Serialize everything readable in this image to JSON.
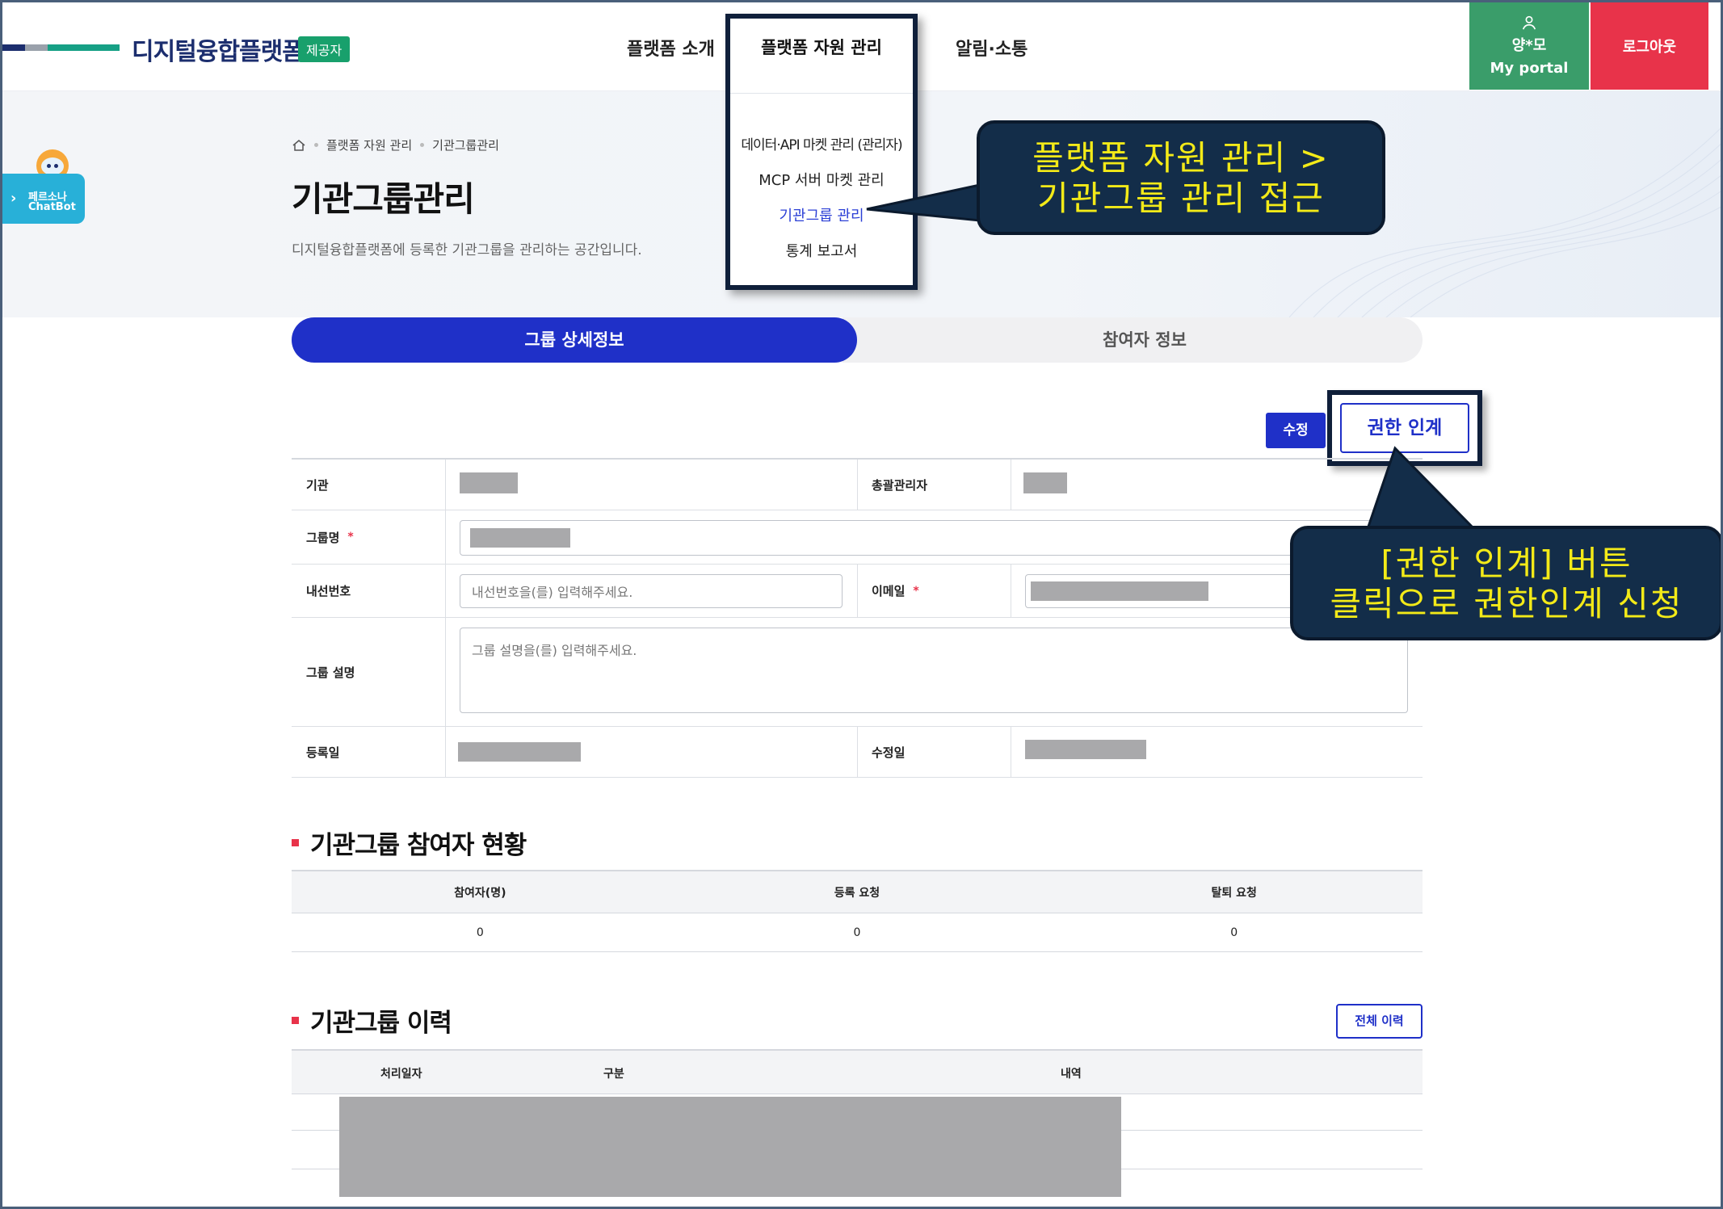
{
  "header": {
    "logo_text": "디지털융합플랫폼",
    "logo_badge": "제공자",
    "nav": [
      "플랫폼 소개",
      "플랫폼 자원 관리",
      "알림·소통"
    ],
    "user_name": "양*모",
    "portal_label": "My portal",
    "logout_label": "로그아웃"
  },
  "dropdown": {
    "title": "플랫폼 자원 관리",
    "items": [
      "데이터·API 마켓 관리 (관리자)",
      "MCP 서버 마켓 관리",
      "기관그룹 관리",
      "통계 보고서"
    ],
    "active_index": 2
  },
  "chatbot": {
    "line1": "페르소나",
    "line2": "ChatBot"
  },
  "breadcrumb": [
    "플랫폼 자원 관리",
    "기관그룹관리"
  ],
  "page": {
    "title": "기관그룹관리",
    "description": "디지털융합플랫폼에 등록한 기관그룹을 관리하는 공간입니다."
  },
  "tabs": [
    {
      "label": "그룹 상세정보",
      "active": true
    },
    {
      "label": "참여자 정보",
      "active": false
    }
  ],
  "actions": {
    "edit": "수정",
    "transfer": "권한 인계"
  },
  "form": {
    "org_label": "기관",
    "admin_label": "총괄관리자",
    "group_name_label": "그룹명",
    "ext_label": "내선번호",
    "ext_placeholder": "내선번호을(를) 입력해주세요.",
    "email_label": "이메일",
    "desc_label": "그룹 설명",
    "desc_placeholder": "그룹 설명을(를) 입력해주세요.",
    "reg_label": "등록일",
    "mod_label": "수정일",
    "required_mark": "*"
  },
  "participants": {
    "title": "기관그룹 참여자 현황",
    "headers": [
      "참여자(명)",
      "등록 요청",
      "탈퇴 요청"
    ],
    "values": [
      "0",
      "0",
      "0"
    ]
  },
  "history": {
    "title": "기관그룹 이력",
    "all_button": "전체 이력",
    "headers": [
      "처리일자",
      "구분",
      "내역"
    ]
  },
  "callouts": {
    "c1_line1": "플랫폼 자원 관리 >",
    "c1_line2": "기관그룹 관리 접근",
    "c2_line1": "[권한 인계] 버튼",
    "c2_line2": "클릭으로 권한인계 신청"
  },
  "colors": {
    "primary": "#1f30c8",
    "brand_navy": "#1c2e6e",
    "portal_green": "#3a9d6a",
    "logout_red": "#e8334a",
    "callout_bg": "#132d49",
    "callout_text": "#f3ea18"
  }
}
